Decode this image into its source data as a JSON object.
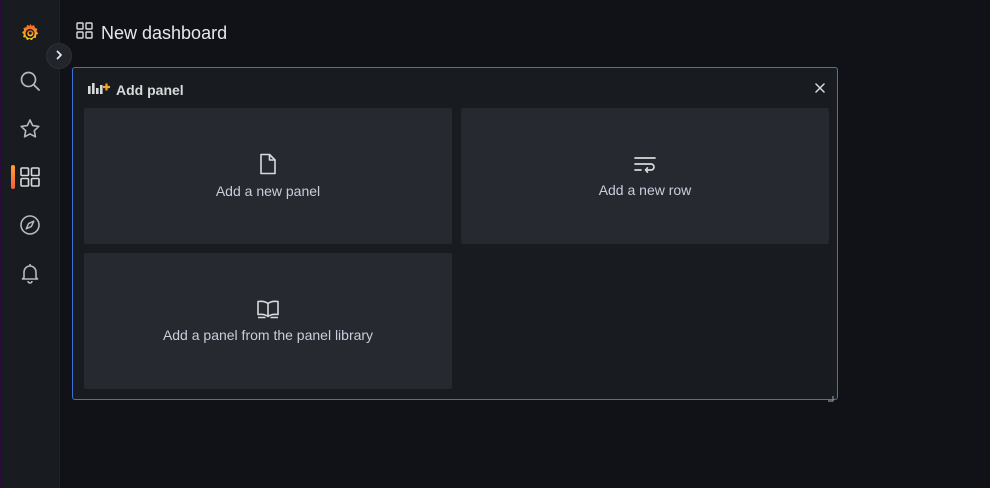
{
  "sidemenu": {
    "logo_icon": "grafana-logo-icon",
    "items": [
      {
        "name": "search",
        "icon": "search-icon"
      },
      {
        "name": "starred",
        "icon": "star-icon"
      },
      {
        "name": "dashboards",
        "icon": "apps-icon",
        "active": true
      },
      {
        "name": "explore",
        "icon": "compass-icon"
      },
      {
        "name": "alerting",
        "icon": "bell-icon"
      }
    ],
    "expand_icon": "chevron-right-icon"
  },
  "header": {
    "icon": "apps-icon",
    "title": "New dashboard"
  },
  "add_panel": {
    "title": "Add panel",
    "icon": "add-panel-chart-icon",
    "close_icon": "close-icon",
    "options": [
      {
        "label": "Add a new panel",
        "icon": "file-icon"
      },
      {
        "label": "Add a new row",
        "icon": "wrap-text-icon"
      },
      {
        "label": "Add a panel from the panel library",
        "icon": "book-open-icon"
      }
    ]
  },
  "colors": {
    "background": "#111217",
    "sidemenu": "#181b1f",
    "panel": "#181b1f",
    "card": "#262930",
    "accent_border": "#3d71d9",
    "brand_orange": "#f05a28",
    "text": "#d8d9da"
  }
}
